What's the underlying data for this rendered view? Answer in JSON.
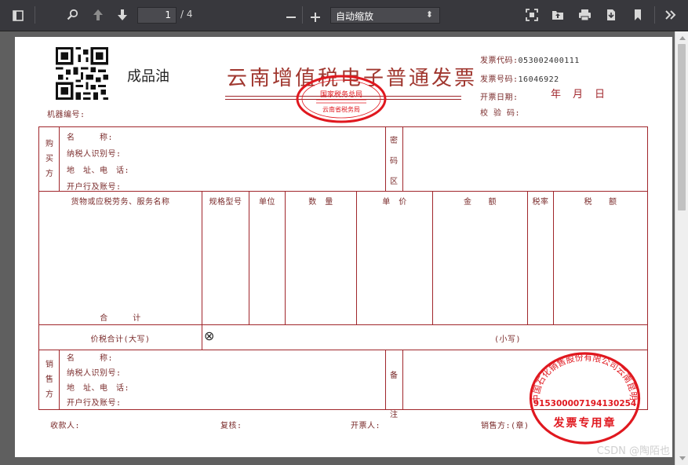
{
  "toolbar": {
    "page_current": "1",
    "page_total": "/ 4",
    "zoom_value": "自动缩放"
  },
  "invoice": {
    "product_type": "成品油",
    "title": "云南增值税电子普通发票",
    "machine_no_label": "机器编号:",
    "code_label": "发票代码:",
    "code_value": "053002400111",
    "number_label": "发票号码:",
    "number_value": "16046922",
    "date_label": "开票日期:",
    "date_year": "年",
    "date_month": "月",
    "date_day": "日",
    "check_label": "校 验 码:",
    "buyer_side": [
      "购",
      "买",
      "方"
    ],
    "party_fields": [
      "名　　　称:",
      "纳税人识别号:",
      "地　址、电　话:",
      "开户行及账号:"
    ],
    "cipher_side": [
      "密",
      "码",
      "区"
    ],
    "columns": {
      "item": "货物或应税劳务、服务名称",
      "spec": "规格型号",
      "unit": "单位",
      "qty": "数　量",
      "price": "单　价",
      "amount": "金　　额",
      "rate": "税率",
      "tax": "税　　额"
    },
    "subtotal": "合　　　计",
    "total_words_label": "价税合计(大写)",
    "total_mark": "⊗",
    "total_small_label": "(小写)",
    "seller_side": [
      "销",
      "售",
      "方"
    ],
    "remark_side": [
      "备",
      "注"
    ],
    "payee_label": "收款人:",
    "reviewer_label": "复核:",
    "drawer_label": "开票人:",
    "seller_seal_label": "销售方:(章)",
    "seal_tax_text": "国家税务总局",
    "seal_tax_sub": "云南省税务局",
    "seal_seller_company": "中国石化销售股份有限公司云南昆明石油分公司",
    "seal_seller_id": "915300007194130254",
    "seal_seller_caption": "发票专用章"
  },
  "watermark": "CSDN @陶陌也",
  "colors": {
    "invoice_red": "#a0262b",
    "seal_red": "#e0181f",
    "toolbar_bg": "#38383d",
    "viewer_bg": "#5f5f5f"
  },
  "icons": [
    "sidebar-toggle-icon",
    "search-icon",
    "arrow-up-icon",
    "arrow-down-icon",
    "minus-icon",
    "plus-icon",
    "fullscreen-icon",
    "open-file-icon",
    "print-icon",
    "download-icon",
    "bookmark-icon",
    "more-tools-icon"
  ]
}
